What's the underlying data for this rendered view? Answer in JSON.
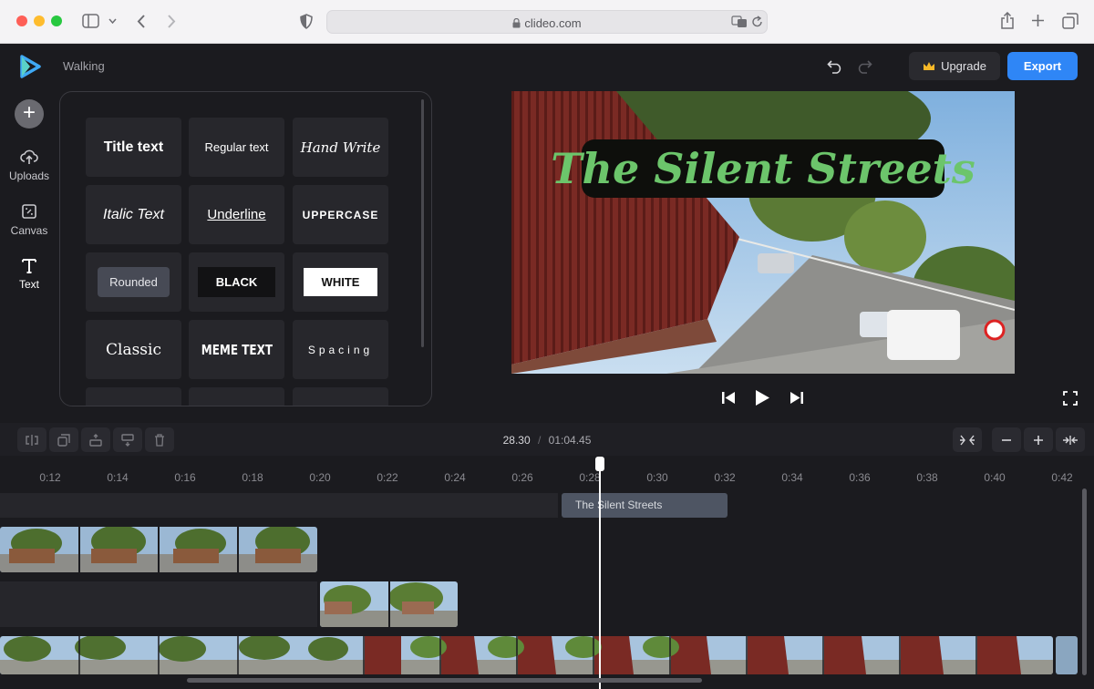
{
  "browser": {
    "url": "clideo.com"
  },
  "header": {
    "project_name": "Walking",
    "upgrade_label": "Upgrade",
    "export_label": "Export"
  },
  "rail": {
    "add_label": "+",
    "items": [
      {
        "label": "Uploads",
        "icon": "cloud-upload-icon"
      },
      {
        "label": "Canvas",
        "icon": "canvas-icon"
      },
      {
        "label": "Text",
        "icon": "text-icon"
      }
    ]
  },
  "text_styles": [
    "Title text",
    "Regular text",
    "Hand Write",
    "Italic Text",
    "Underline",
    "UPPERCASE",
    "Rounded",
    "BLACK",
    "WHITE",
    "Classic",
    "MEME TEXT",
    "Spacing"
  ],
  "preview": {
    "overlay_title": "The Silent Streets"
  },
  "timeline": {
    "current_time": "28.30",
    "separator": "/",
    "total_time": "01:04.45",
    "ruler_ticks": [
      "0:12",
      "0:14",
      "0:16",
      "0:18",
      "0:20",
      "0:22",
      "0:24",
      "0:26",
      "0:28",
      "0:30",
      "0:32",
      "0:34",
      "0:36",
      "0:38",
      "0:40",
      "0:42"
    ],
    "text_clip_label": "The Silent Streets"
  },
  "colors": {
    "accent": "#2f86f6",
    "title_text": "#6cc56b",
    "background": "#1b1b1f"
  }
}
